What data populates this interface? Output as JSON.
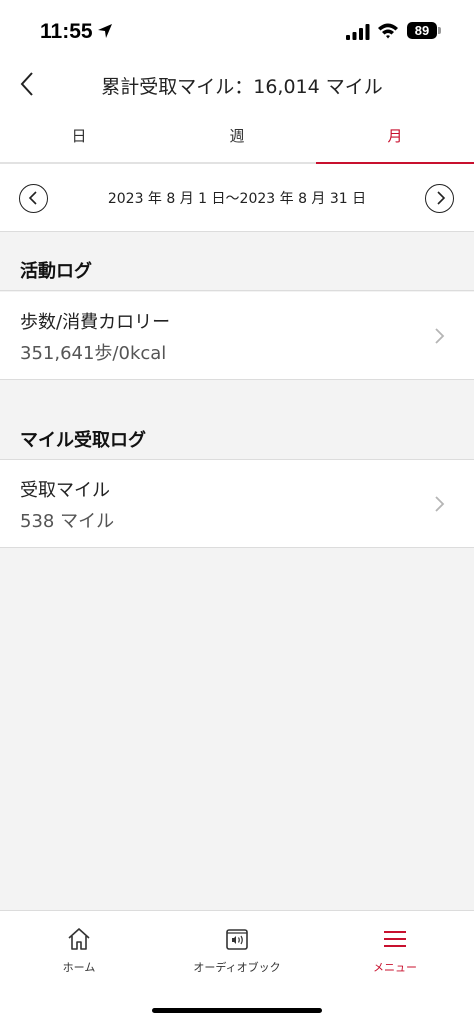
{
  "status_bar": {
    "time": "11:55",
    "battery": "89"
  },
  "header": {
    "title": "累計受取マイル：16,014 マイル"
  },
  "tabs": [
    {
      "label": "日",
      "active": false
    },
    {
      "label": "週",
      "active": false
    },
    {
      "label": "月",
      "active": true
    }
  ],
  "date_nav": {
    "range": "2023 年 8 月 1 日〜2023 年 8 月 31 日"
  },
  "activity": {
    "section_title": "活動ログ",
    "row_title": "歩数/消費カロリー",
    "row_value": "351,641歩/0kcal"
  },
  "miles": {
    "section_title": "マイル受取ログ",
    "row_title": "受取マイル",
    "row_value": "538 マイル"
  },
  "bottom_nav": {
    "home": "ホーム",
    "audio": "オーディオブック",
    "menu": "メニュー"
  },
  "colors": {
    "accent": "#c8102e",
    "background": "#f3f3f3"
  }
}
